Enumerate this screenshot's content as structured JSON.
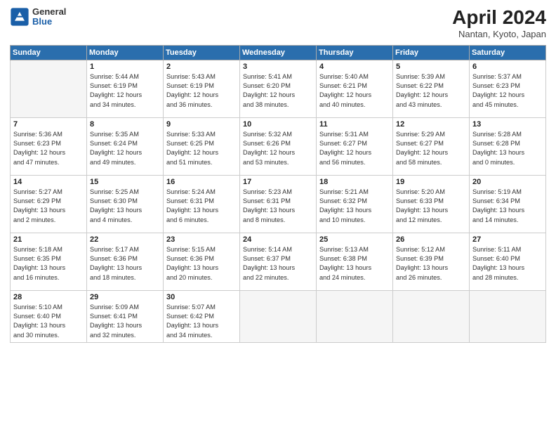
{
  "header": {
    "logo_general": "General",
    "logo_blue": "Blue",
    "month_title": "April 2024",
    "location": "Nantan, Kyoto, Japan"
  },
  "weekdays": [
    "Sunday",
    "Monday",
    "Tuesday",
    "Wednesday",
    "Thursday",
    "Friday",
    "Saturday"
  ],
  "weeks": [
    [
      {
        "day": "",
        "info": ""
      },
      {
        "day": "1",
        "info": "Sunrise: 5:44 AM\nSunset: 6:19 PM\nDaylight: 12 hours\nand 34 minutes."
      },
      {
        "day": "2",
        "info": "Sunrise: 5:43 AM\nSunset: 6:19 PM\nDaylight: 12 hours\nand 36 minutes."
      },
      {
        "day": "3",
        "info": "Sunrise: 5:41 AM\nSunset: 6:20 PM\nDaylight: 12 hours\nand 38 minutes."
      },
      {
        "day": "4",
        "info": "Sunrise: 5:40 AM\nSunset: 6:21 PM\nDaylight: 12 hours\nand 40 minutes."
      },
      {
        "day": "5",
        "info": "Sunrise: 5:39 AM\nSunset: 6:22 PM\nDaylight: 12 hours\nand 43 minutes."
      },
      {
        "day": "6",
        "info": "Sunrise: 5:37 AM\nSunset: 6:23 PM\nDaylight: 12 hours\nand 45 minutes."
      }
    ],
    [
      {
        "day": "7",
        "info": "Sunrise: 5:36 AM\nSunset: 6:23 PM\nDaylight: 12 hours\nand 47 minutes."
      },
      {
        "day": "8",
        "info": "Sunrise: 5:35 AM\nSunset: 6:24 PM\nDaylight: 12 hours\nand 49 minutes."
      },
      {
        "day": "9",
        "info": "Sunrise: 5:33 AM\nSunset: 6:25 PM\nDaylight: 12 hours\nand 51 minutes."
      },
      {
        "day": "10",
        "info": "Sunrise: 5:32 AM\nSunset: 6:26 PM\nDaylight: 12 hours\nand 53 minutes."
      },
      {
        "day": "11",
        "info": "Sunrise: 5:31 AM\nSunset: 6:27 PM\nDaylight: 12 hours\nand 56 minutes."
      },
      {
        "day": "12",
        "info": "Sunrise: 5:29 AM\nSunset: 6:27 PM\nDaylight: 12 hours\nand 58 minutes."
      },
      {
        "day": "13",
        "info": "Sunrise: 5:28 AM\nSunset: 6:28 PM\nDaylight: 13 hours\nand 0 minutes."
      }
    ],
    [
      {
        "day": "14",
        "info": "Sunrise: 5:27 AM\nSunset: 6:29 PM\nDaylight: 13 hours\nand 2 minutes."
      },
      {
        "day": "15",
        "info": "Sunrise: 5:25 AM\nSunset: 6:30 PM\nDaylight: 13 hours\nand 4 minutes."
      },
      {
        "day": "16",
        "info": "Sunrise: 5:24 AM\nSunset: 6:31 PM\nDaylight: 13 hours\nand 6 minutes."
      },
      {
        "day": "17",
        "info": "Sunrise: 5:23 AM\nSunset: 6:31 PM\nDaylight: 13 hours\nand 8 minutes."
      },
      {
        "day": "18",
        "info": "Sunrise: 5:21 AM\nSunset: 6:32 PM\nDaylight: 13 hours\nand 10 minutes."
      },
      {
        "day": "19",
        "info": "Sunrise: 5:20 AM\nSunset: 6:33 PM\nDaylight: 13 hours\nand 12 minutes."
      },
      {
        "day": "20",
        "info": "Sunrise: 5:19 AM\nSunset: 6:34 PM\nDaylight: 13 hours\nand 14 minutes."
      }
    ],
    [
      {
        "day": "21",
        "info": "Sunrise: 5:18 AM\nSunset: 6:35 PM\nDaylight: 13 hours\nand 16 minutes."
      },
      {
        "day": "22",
        "info": "Sunrise: 5:17 AM\nSunset: 6:36 PM\nDaylight: 13 hours\nand 18 minutes."
      },
      {
        "day": "23",
        "info": "Sunrise: 5:15 AM\nSunset: 6:36 PM\nDaylight: 13 hours\nand 20 minutes."
      },
      {
        "day": "24",
        "info": "Sunrise: 5:14 AM\nSunset: 6:37 PM\nDaylight: 13 hours\nand 22 minutes."
      },
      {
        "day": "25",
        "info": "Sunrise: 5:13 AM\nSunset: 6:38 PM\nDaylight: 13 hours\nand 24 minutes."
      },
      {
        "day": "26",
        "info": "Sunrise: 5:12 AM\nSunset: 6:39 PM\nDaylight: 13 hours\nand 26 minutes."
      },
      {
        "day": "27",
        "info": "Sunrise: 5:11 AM\nSunset: 6:40 PM\nDaylight: 13 hours\nand 28 minutes."
      }
    ],
    [
      {
        "day": "28",
        "info": "Sunrise: 5:10 AM\nSunset: 6:40 PM\nDaylight: 13 hours\nand 30 minutes."
      },
      {
        "day": "29",
        "info": "Sunrise: 5:09 AM\nSunset: 6:41 PM\nDaylight: 13 hours\nand 32 minutes."
      },
      {
        "day": "30",
        "info": "Sunrise: 5:07 AM\nSunset: 6:42 PM\nDaylight: 13 hours\nand 34 minutes."
      },
      {
        "day": "",
        "info": ""
      },
      {
        "day": "",
        "info": ""
      },
      {
        "day": "",
        "info": ""
      },
      {
        "day": "",
        "info": ""
      }
    ]
  ]
}
